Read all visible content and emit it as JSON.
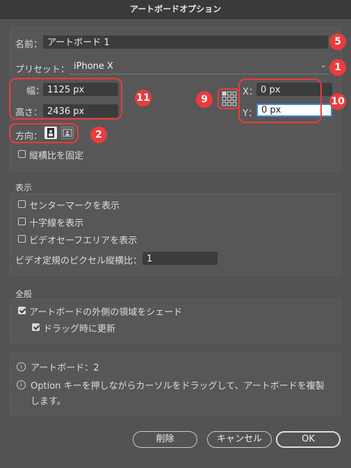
{
  "window": {
    "title": "アートボードオプション"
  },
  "name": {
    "label": "名前：",
    "value": "アートボード 1"
  },
  "preset": {
    "label": "プリセット：",
    "value": "iPhone X"
  },
  "size": {
    "width_label": "幅：",
    "width_value": "1125 px",
    "height_label": "高さ：",
    "height_value": "2436 px"
  },
  "position": {
    "x_label": "X：",
    "x_value": "0 px",
    "y_label": "Y：",
    "y_value": "0 px"
  },
  "orientation": {
    "label": "方向："
  },
  "constrain": {
    "label": "縦横比を固定",
    "checked": false
  },
  "display": {
    "heading": "表示",
    "center_mark": "センターマークを表示",
    "crosshair": "十字線を表示",
    "video_safe": "ビデオセーフエリアを表示",
    "par_label": "ビデオ定規のピクセル縦横比：",
    "par_value": "1"
  },
  "general": {
    "heading": "全般",
    "shade_outside": "アートボードの外側の領域をシェード",
    "update_while_drag": "ドラッグ時に更新"
  },
  "info": {
    "artboards": "アートボード：2",
    "tip_line1": "Option キーを押しながらカーソルをドラッグして、アートボードを複製",
    "tip_line2": "します。"
  },
  "buttons": {
    "delete": "削除",
    "cancel": "キャンセル",
    "ok": "OK"
  },
  "annotations": {
    "b1": "1",
    "b2": "2",
    "b5": "5",
    "b9": "9",
    "b10": "10",
    "b11": "11"
  },
  "colors": {
    "annotation": "#ec3b3b",
    "focus": "#3d86d9"
  }
}
